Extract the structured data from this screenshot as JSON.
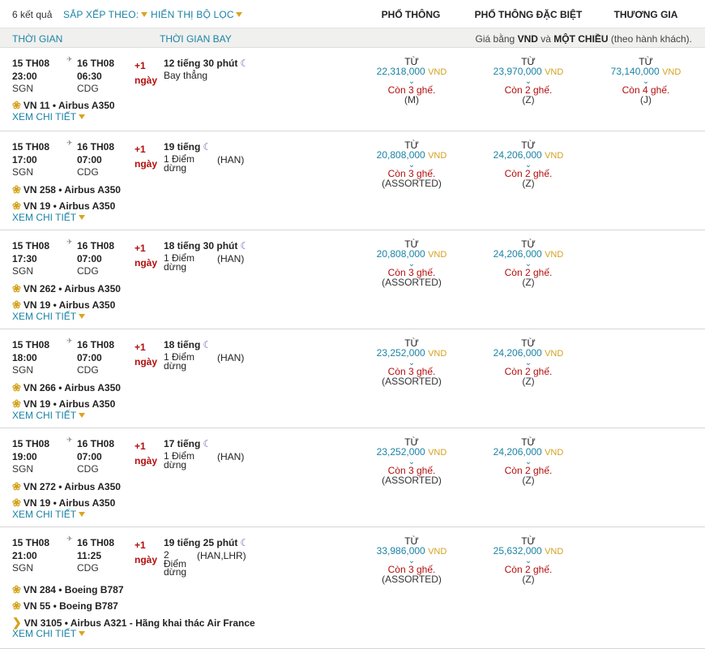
{
  "topbar": {
    "result_count": "6 kết quả",
    "sort_label": "SẮP XẾP THEO:",
    "filter_label": "HIỂN THỊ BỘ LỌC",
    "col_economy": "PHỔ THÔNG",
    "col_premium": "PHỔ THÔNG ĐẶC BIỆT",
    "col_business": "THƯƠNG GIA"
  },
  "subbar": {
    "time_label": "THỜI GIAN",
    "duration_label": "THỜI GIAN BAY",
    "note_pre": "Giá bằng ",
    "note_currency": "VND",
    "note_mid": " và ",
    "note_trip": "MỘT CHIỀU",
    "note_post": " (theo hành khách)."
  },
  "common": {
    "plus_day": "+1",
    "day": "ngày",
    "from": "TỪ",
    "currency": "VND",
    "detail": "XEM CHI TIẾT"
  },
  "flights": [
    {
      "dep_date": "15 TH08",
      "dep_time": "23:00",
      "dep_code": "SGN",
      "arr_date": "16 TH08",
      "arr_time": "06:30",
      "arr_code": "CDG",
      "duration": "12 tiếng 30 phút",
      "stops_l1": "Bay thẳng",
      "stops_l2": "",
      "stops_l3": "",
      "via": "",
      "segments": [
        "VN 11 • Airbus A350"
      ],
      "fares": [
        {
          "price": "22,318,000",
          "seats": "Còn 3 ghế.",
          "class": "(M)"
        },
        {
          "price": "23,970,000",
          "seats": "Còn 2 ghế.",
          "class": "(Z)"
        },
        {
          "price": "73,140,000",
          "seats": "Còn 4 ghế.",
          "class": "(J)"
        }
      ]
    },
    {
      "dep_date": "15 TH08",
      "dep_time": "17:00",
      "dep_code": "SGN",
      "arr_date": "16 TH08",
      "arr_time": "07:00",
      "arr_code": "CDG",
      "duration": "19 tiếng",
      "stops_l1": "1 Điểm",
      "stops_l2": "dừng",
      "stops_l3": "",
      "via": "(HAN)",
      "segments": [
        "VN 258 • Airbus A350",
        "VN 19 • Airbus A350"
      ],
      "fares": [
        {
          "price": "20,808,000",
          "seats": "Còn 3 ghế.",
          "class": "(ASSORTED)"
        },
        {
          "price": "24,206,000",
          "seats": "Còn 2 ghế.",
          "class": "(Z)"
        }
      ]
    },
    {
      "dep_date": "15 TH08",
      "dep_time": "17:30",
      "dep_code": "SGN",
      "arr_date": "16 TH08",
      "arr_time": "07:00",
      "arr_code": "CDG",
      "duration": "18 tiếng 30 phút",
      "stops_l1": "1 Điểm",
      "stops_l2": "dừng",
      "stops_l3": "",
      "via": "(HAN)",
      "segments": [
        "VN 262 • Airbus A350",
        "VN 19 • Airbus A350"
      ],
      "fares": [
        {
          "price": "20,808,000",
          "seats": "Còn 3 ghế.",
          "class": "(ASSORTED)"
        },
        {
          "price": "24,206,000",
          "seats": "Còn 2 ghế.",
          "class": "(Z)"
        }
      ]
    },
    {
      "dep_date": "15 TH08",
      "dep_time": "18:00",
      "dep_code": "SGN",
      "arr_date": "16 TH08",
      "arr_time": "07:00",
      "arr_code": "CDG",
      "duration": "18 tiếng",
      "stops_l1": "1 Điểm",
      "stops_l2": "dừng",
      "stops_l3": "",
      "via": "(HAN)",
      "segments": [
        "VN 266 • Airbus A350",
        "VN 19 • Airbus A350"
      ],
      "fares": [
        {
          "price": "23,252,000",
          "seats": "Còn 3 ghế.",
          "class": "(ASSORTED)"
        },
        {
          "price": "24,206,000",
          "seats": "Còn 2 ghế.",
          "class": "(Z)"
        }
      ]
    },
    {
      "dep_date": "15 TH08",
      "dep_time": "19:00",
      "dep_code": "SGN",
      "arr_date": "16 TH08",
      "arr_time": "07:00",
      "arr_code": "CDG",
      "duration": "17 tiếng",
      "stops_l1": "1 Điểm",
      "stops_l2": "dừng",
      "stops_l3": "",
      "via": "(HAN)",
      "segments": [
        "VN 272 • Airbus A350",
        "VN 19 • Airbus A350"
      ],
      "fares": [
        {
          "price": "23,252,000",
          "seats": "Còn 3 ghế.",
          "class": "(ASSORTED)"
        },
        {
          "price": "24,206,000",
          "seats": "Còn 2 ghế.",
          "class": "(Z)"
        }
      ]
    },
    {
      "dep_date": "15 TH08",
      "dep_time": "21:00",
      "dep_code": "SGN",
      "arr_date": "16 TH08",
      "arr_time": "11:25",
      "arr_code": "CDG",
      "duration": "19 tiếng 25 phút",
      "stops_l1": "2",
      "stops_l2": "Điểm",
      "stops_l3": "dừng",
      "via": "(HAN,LHR)",
      "segments": [
        "VN 284 • Boeing B787",
        "VN 55 • Boeing B787",
        "VN 3105 • Airbus A321  -  Hãng khai thác Air France"
      ],
      "fares": [
        {
          "price": "33,986,000",
          "seats": "Còn 3 ghế.",
          "class": "(ASSORTED)"
        },
        {
          "price": "25,632,000",
          "seats": "Còn 2 ghế.",
          "class": "(Z)"
        }
      ]
    }
  ],
  "colors": {
    "accent": "#1b83a5",
    "gold": "#d4a21d",
    "seat_red": "#b30d0d"
  }
}
